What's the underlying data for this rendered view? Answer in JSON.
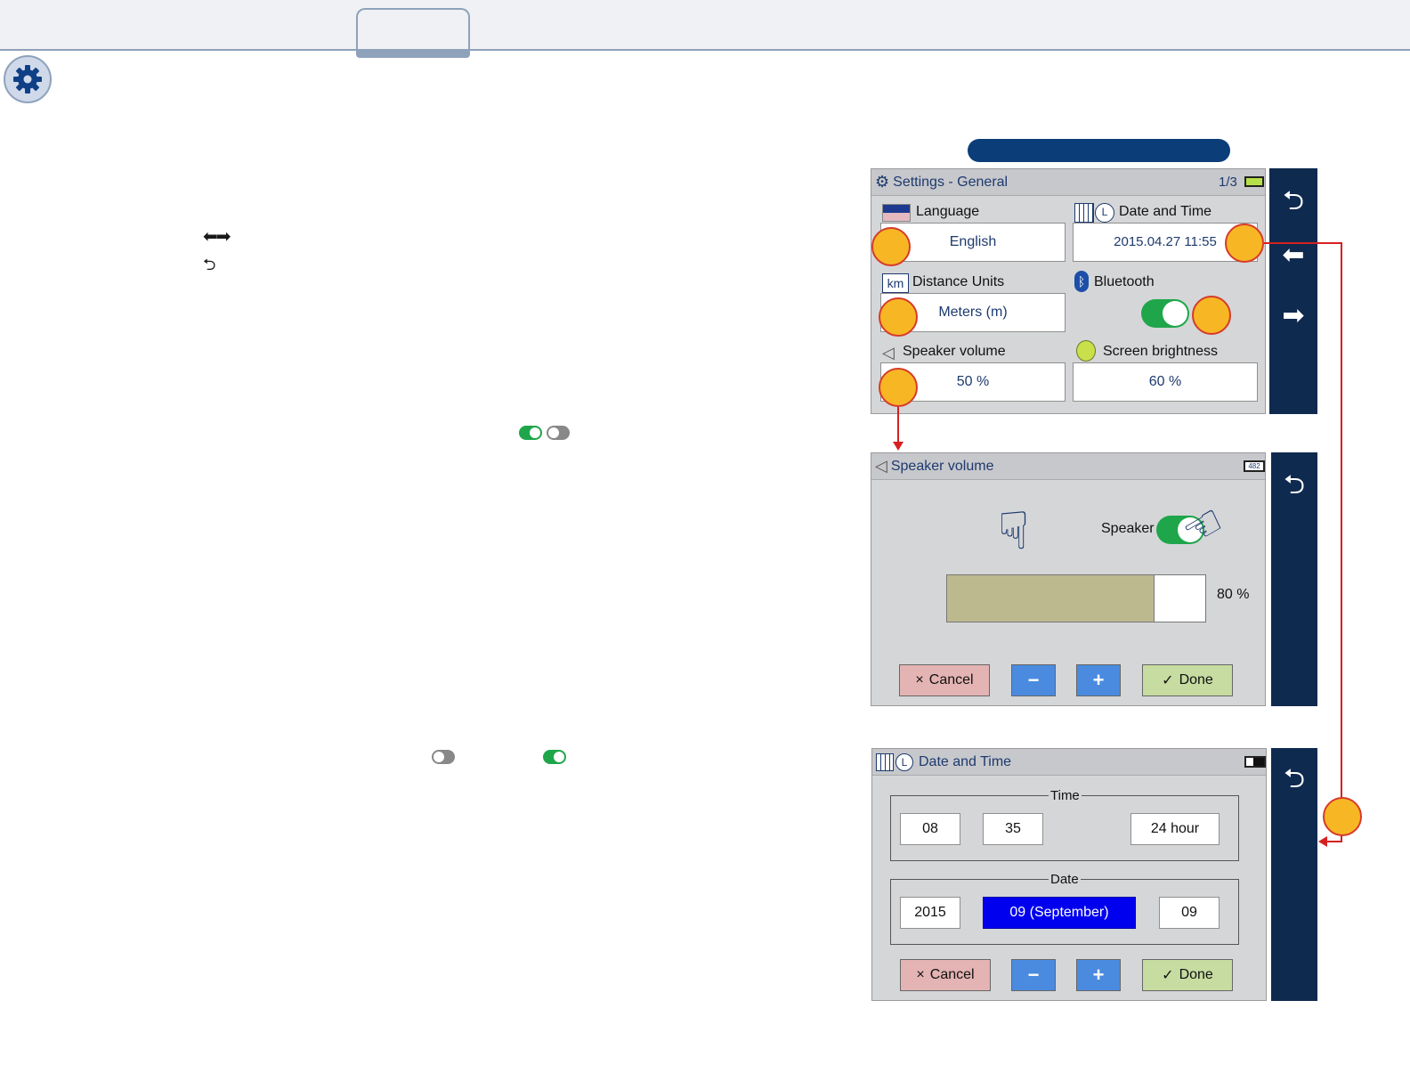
{
  "settings_screen": {
    "title": "Settings - General",
    "page": "1/3",
    "language_label": "Language",
    "language_value": "English",
    "datetime_label": "Date and Time",
    "datetime_value": "2015.04.27  11:55",
    "distance_label": "Distance Units",
    "distance_icon_text": "km",
    "distance_value": "Meters (m)",
    "bluetooth_label": "Bluetooth",
    "bluetooth_on": true,
    "speaker_label": "Speaker volume",
    "speaker_value": "50 %",
    "brightness_label": "Screen brightness",
    "brightness_value": "60 %"
  },
  "speaker_screen": {
    "title": "Speaker volume",
    "battery_text": "482",
    "speaker_toggle_label": "Speaker",
    "speaker_on": true,
    "volume_percent": 80,
    "volume_text": "80 %",
    "cancel_label": "Cancel",
    "done_label": "Done",
    "minus_label": "−",
    "plus_label": "+"
  },
  "datetime_screen": {
    "title": "Date and Time",
    "time_legend": "Time",
    "hour": "08",
    "minute": "35",
    "format": "24 hour",
    "date_legend": "Date",
    "year": "2015",
    "month": "09 (September)",
    "day": "09",
    "cancel_label": "Cancel",
    "done_label": "Done",
    "minus_label": "−",
    "plus_label": "+"
  },
  "icons": {
    "cancel_mark": "×",
    "done_mark": "✓",
    "back": "⮌",
    "nav_left": "⬅",
    "nav_right": "➡",
    "arrows_text": "⬅➡",
    "back_text": "⮌"
  },
  "colors": {
    "accent_navy": "#0f2a4f",
    "toggle_green": "#1fa64a",
    "marker_fill": "#f7b724",
    "selected_month": "#0000ee"
  }
}
